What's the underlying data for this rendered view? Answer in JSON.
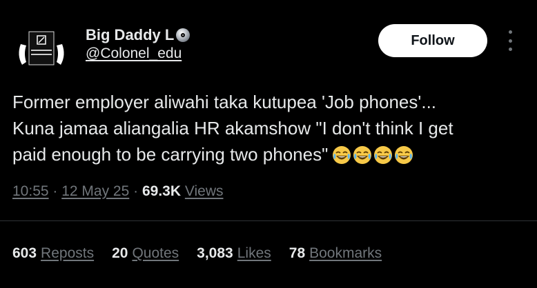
{
  "author": {
    "display_name": "Big Daddy L",
    "name_icon": "cd-disc-icon",
    "handle": "@Colonel_edu",
    "avatar_icon": "avatar-logo-icon"
  },
  "follow_button": {
    "label": "Follow"
  },
  "more_menu_icon": "more-vertical-icon",
  "tweet": {
    "text": "Former employer aliwahi taka kutupea 'Job phones'...\nKuna jamaa aliangalia HR akamshow \"I don't think I get\npaid enough to be carrying two phones\"",
    "emoji_icons": [
      "joy-emoji-icon",
      "joy-emoji-icon",
      "joy-emoji-icon",
      "joy-emoji-icon"
    ]
  },
  "meta": {
    "time": "10:55",
    "sep1": " · ",
    "date": "12 May 25",
    "sep2": " · ",
    "views_count": "69.3K",
    "views_label": "Views"
  },
  "stats": [
    {
      "count": "603",
      "label": "Reposts"
    },
    {
      "count": "20",
      "label": "Quotes"
    },
    {
      "count": "3,083",
      "label": "Likes"
    },
    {
      "count": "78",
      "label": "Bookmarks"
    }
  ],
  "colors": {
    "background": "#000000",
    "text_primary": "#e7e9ea",
    "text_secondary": "#71767b",
    "button_bg": "#ffffff",
    "divider": "#2f3336"
  }
}
